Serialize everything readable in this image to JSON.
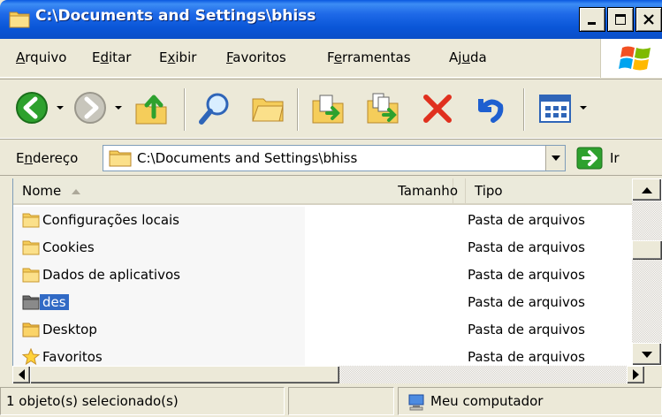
{
  "window": {
    "title": "C:\\Documents and Settings\\bhiss"
  },
  "menu": {
    "items": [
      {
        "pre": "",
        "u": "A",
        "post": "rquivo"
      },
      {
        "pre": "E",
        "u": "d",
        "post": "itar"
      },
      {
        "pre": "E",
        "u": "x",
        "post": "ibir"
      },
      {
        "pre": "",
        "u": "F",
        "post": "avoritos"
      },
      {
        "pre": "F",
        "u": "e",
        "post": "rramentas"
      },
      {
        "pre": "Aj",
        "u": "u",
        "post": "da"
      }
    ]
  },
  "toolbar": {
    "icons": [
      "back-icon",
      "forward-icon",
      "up-folder-icon",
      "search-icon",
      "folders-icon",
      "move-to-icon",
      "copy-to-icon",
      "delete-icon",
      "undo-icon",
      "views-icon"
    ]
  },
  "address": {
    "label_pre": "E",
    "label_u": "n",
    "label_post": "dereço",
    "path": "C:\\Documents and Settings\\bhiss",
    "go_label": "Ir"
  },
  "columns": {
    "name": "Nome",
    "size": "Tamanho",
    "type": "Tipo"
  },
  "files": [
    {
      "name": "Configurações locais",
      "type": "Pasta de arquivos",
      "icon": "folder-icon",
      "selected": false
    },
    {
      "name": "Cookies",
      "type": "Pasta de arquivos",
      "icon": "folder-icon",
      "selected": false
    },
    {
      "name": "Dados de aplicativos",
      "type": "Pasta de arquivos",
      "icon": "folder-icon",
      "selected": false
    },
    {
      "name": "des",
      "type": "Pasta de arquivos",
      "icon": "folder-icon",
      "selected": true
    },
    {
      "name": "Desktop",
      "type": "Pasta de arquivos",
      "icon": "folder-icon",
      "selected": false
    },
    {
      "name": "Favoritos",
      "type": "Pasta de arquivos",
      "icon": "star-folder-icon",
      "selected": false
    }
  ],
  "status": {
    "selection": "1 objeto(s) selecionado(s)",
    "location": "Meu computador"
  },
  "colors": {
    "titlebar": "#0A56D8",
    "selection": "#316AC5"
  }
}
